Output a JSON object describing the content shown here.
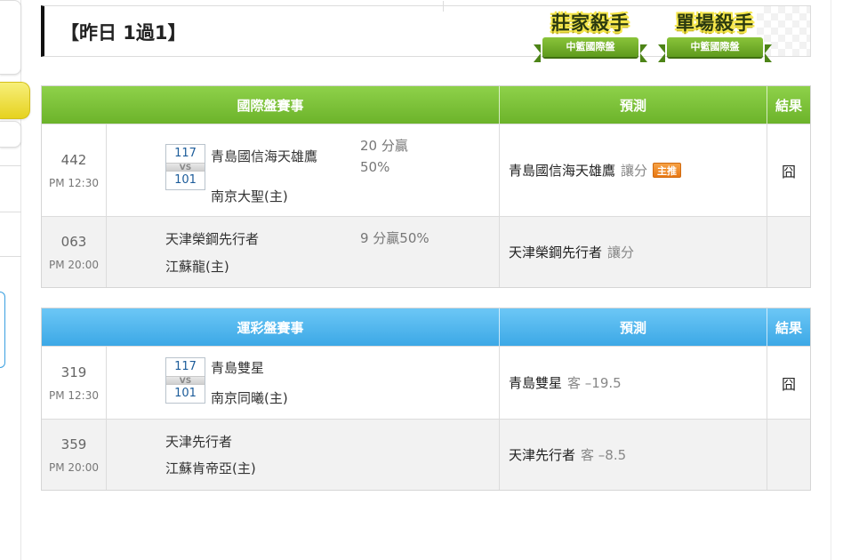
{
  "banner": {
    "title": "【昨日 1過1】",
    "badges": [
      {
        "title": "莊家殺手",
        "ribbon": "中籃國際盤"
      },
      {
        "title": "單場殺手",
        "ribbon": "中籃國際盤"
      }
    ]
  },
  "colors": {
    "green_header": "#7cc23a",
    "blue_header": "#4fb5ee",
    "tag_orange": "#f08a24"
  },
  "international": {
    "headers": {
      "event": "國際盤賽事",
      "prediction": "預測",
      "result": "結果"
    },
    "rows": [
      {
        "no": "442",
        "time": "PM 12:30",
        "score_home": "117",
        "vs": "VS",
        "score_away": "101",
        "team1": "青島國信海天雄鷹",
        "team2": "南京大聖(主)",
        "odds1": "20 分贏",
        "odds2": "50%",
        "pred_team": "青島國信海天雄鷹",
        "pred_type": "讓分",
        "pred_tag": "主推",
        "result": "囧"
      },
      {
        "no": "063",
        "time": "PM 20:00",
        "team1": "天津榮鋼先行者",
        "team2": "江蘇龍(主)",
        "odds1": "9 分贏50%",
        "pred_team": "天津榮鋼先行者",
        "pred_type": "讓分",
        "result": ""
      }
    ]
  },
  "lottery": {
    "headers": {
      "event": "運彩盤賽事",
      "prediction": "預測",
      "result": "結果"
    },
    "rows": [
      {
        "no": "319",
        "time": "PM 12:30",
        "score_home": "117",
        "vs": "VS",
        "score_away": "101",
        "team1": "青島雙星",
        "team2": "南京同曦(主)",
        "pred_team": "青島雙星",
        "pred_type": "客 –19.5",
        "result": "囧"
      },
      {
        "no": "359",
        "time": "PM 20:00",
        "team1": "天津先行者",
        "team2": "江蘇肯帝亞(主)",
        "pred_team": "天津先行者",
        "pred_type": "客 –8.5",
        "result": ""
      }
    ]
  }
}
